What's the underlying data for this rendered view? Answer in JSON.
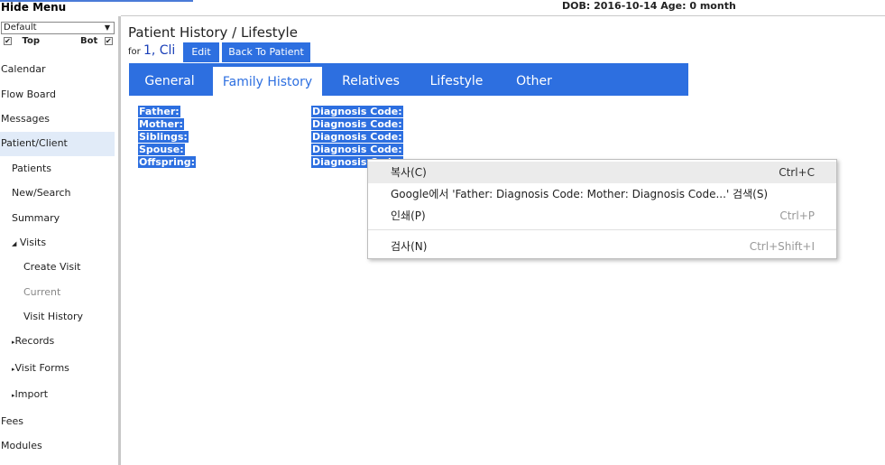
{
  "topbar": {
    "hide_menu": "Hide Menu",
    "dob": "DOB: 2016-10-14 Age: 0 month"
  },
  "sidebar": {
    "select_value": "Default",
    "top_label": "Top",
    "bot_label": "Bot",
    "items": [
      {
        "label": "Calendar"
      },
      {
        "label": "Flow Board"
      },
      {
        "label": "Messages"
      },
      {
        "label": "Patient/Client"
      },
      {
        "label": "Patients"
      },
      {
        "label": "New/Search"
      },
      {
        "label": "Summary"
      },
      {
        "label": "Visits"
      },
      {
        "label": "Create Visit"
      },
      {
        "label": "Current"
      },
      {
        "label": "Visit History"
      },
      {
        "label": "Records"
      },
      {
        "label": "Visit Forms"
      },
      {
        "label": "Import"
      },
      {
        "label": "Fees"
      },
      {
        "label": "Modules"
      }
    ]
  },
  "header": {
    "title": "Patient History / Lifestyle",
    "for_prefix": "for",
    "patient_name": "1, Cli",
    "edit_label": "Edit",
    "back_label": "Back To Patient"
  },
  "tabs": [
    {
      "label": "General"
    },
    {
      "label": "Family History"
    },
    {
      "label": "Relatives"
    },
    {
      "label": "Lifestyle"
    },
    {
      "label": "Other"
    }
  ],
  "family_history": {
    "rows": [
      {
        "relation": "Father:",
        "diagnosis": "Diagnosis Code:"
      },
      {
        "relation": "Mother:",
        "diagnosis": "Diagnosis Code:"
      },
      {
        "relation": "Siblings:",
        "diagnosis": "Diagnosis Code:"
      },
      {
        "relation": "Spouse:",
        "diagnosis": "Diagnosis Code:"
      },
      {
        "relation": "Offspring:",
        "diagnosis": "Diagnosis Code:"
      }
    ]
  },
  "context_menu": {
    "items": [
      {
        "label": "복사(C)",
        "shortcut": "Ctrl+C"
      },
      {
        "label": "Google에서 'Father:  Diagnosis Code:  Mother:  Diagnosis Code...' 검색(S)",
        "shortcut": ""
      },
      {
        "label": "인쇄(P)",
        "shortcut": "Ctrl+P"
      },
      {
        "label": "검사(N)",
        "shortcut": "Ctrl+Shift+I"
      }
    ]
  },
  "colors": {
    "accent": "#2d6fe0",
    "selection": "#2d6fe0",
    "active_nav": "#e1ebf8"
  }
}
